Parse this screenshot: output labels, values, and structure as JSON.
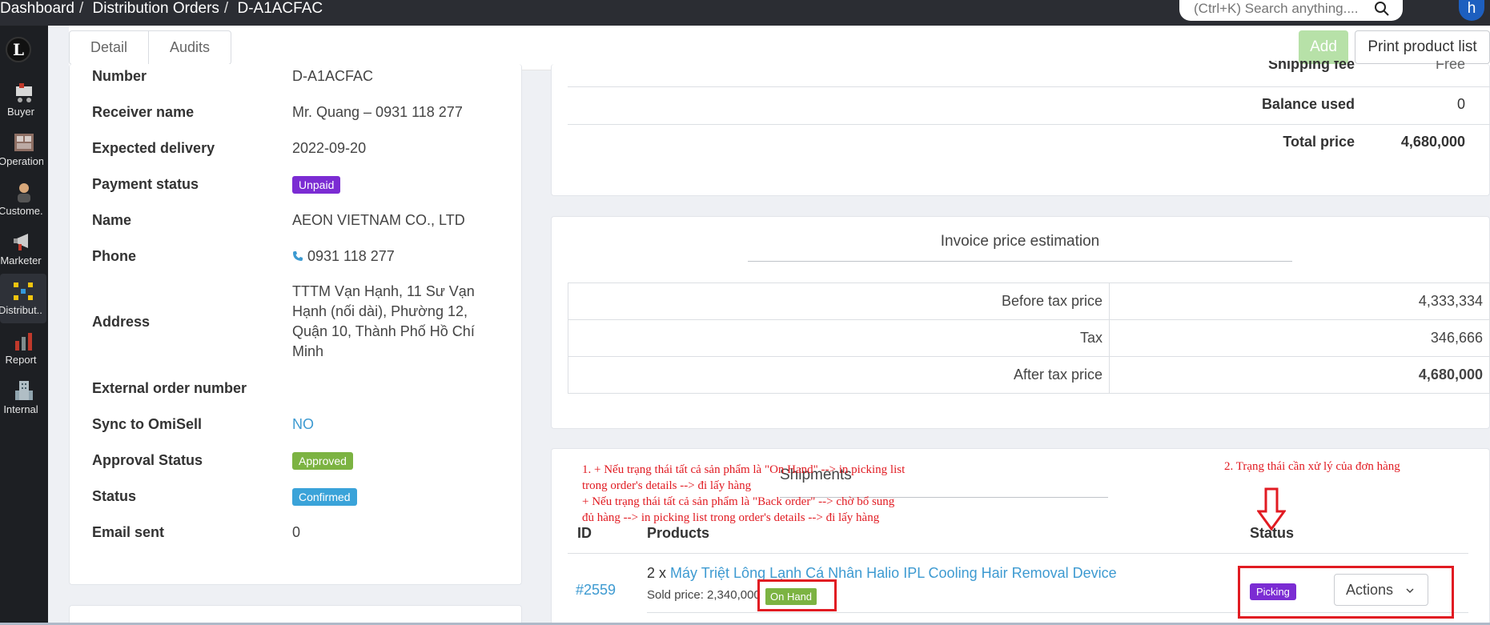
{
  "topbar": {
    "breadcrumb": [
      "Dashboard",
      "Distribution Orders",
      "D-A1ACFAC"
    ],
    "search_placeholder": "(Ctrl+K) Search anything....",
    "avatar_initial": "h"
  },
  "sidebar": {
    "logo": "L",
    "items": [
      {
        "label": "Buyer",
        "icon": "cart-icon"
      },
      {
        "label": "Operation",
        "icon": "warehouse-icon"
      },
      {
        "label": "Custome...",
        "icon": "customer-icon"
      },
      {
        "label": "Marketer",
        "icon": "megaphone-icon"
      },
      {
        "label": "Distribut...",
        "icon": "distribution-icon"
      },
      {
        "label": "Report",
        "icon": "report-icon"
      },
      {
        "label": "Internal",
        "icon": "building-icon"
      }
    ]
  },
  "tabs": [
    "Detail",
    "Audits"
  ],
  "buttons": {
    "add": "Add",
    "print": "Print product list"
  },
  "details": {
    "number_label": "Number",
    "number": "D-A1ACFAC",
    "receiver_label": "Receiver name",
    "receiver": "Mr. Quang – 0931 118 277",
    "expected_label": "Expected delivery",
    "expected": "2022-09-20",
    "payment_label": "Payment status",
    "payment": "Unpaid",
    "name_label": "Name",
    "name": "AEON VIETNAM CO., LTD",
    "phone_label": "Phone",
    "phone": "0931 118 277",
    "address_label": "Address",
    "address_lines": [
      "TTTM Vạn Hạnh, 11 Sư Vạn",
      "Hạnh (nối dài), Phường 12,",
      "Quận 10, Thành Phố Hồ Chí",
      "Minh"
    ],
    "external_label": "External order number",
    "external": "",
    "sync_label": "Sync to OmiSell",
    "sync": "NO",
    "approval_label": "Approval Status",
    "approval": "Approved",
    "status_label": "Status",
    "status": "Confirmed",
    "email_label": "Email sent",
    "email": "0"
  },
  "summary": {
    "shipping_label": "Shipping fee",
    "shipping": "Free",
    "balance_label": "Balance used",
    "balance": "0",
    "total_label": "Total price",
    "total": "4,680,000"
  },
  "invoice": {
    "title": "Invoice price estimation",
    "rows": [
      {
        "label": "Before tax price",
        "value": "4,333,334"
      },
      {
        "label": "Tax",
        "value": "346,666"
      },
      {
        "label": "After tax price",
        "value": "4,680,000"
      }
    ]
  },
  "shipments": {
    "title": "Shipments",
    "col_id": "ID",
    "col_products": "Products",
    "col_status": "Status",
    "order_id": "#2559",
    "qty": "2 x",
    "product": "Máy Triệt Lông Lạnh Cá Nhân Halio IPL Cooling Hair Removal Device",
    "sold_price": "Sold price: 2,340,000",
    "stock_badge": "On Hand",
    "status_badge": "Picking",
    "actions": "Actions"
  },
  "annotations": {
    "note1_lines": [
      "1. + Nếu trạng thái tất cả sản phẩm là \"On Hand\" --> in picking list",
      "trong order's details --> đi lấy hàng",
      "    + Nếu trạng thái tất cả sản phẩm là \"Back order\" --> chờ bổ sung",
      "đủ hàng -->  in picking list trong order's details --> đi lấy hàng"
    ],
    "note2": "2. Trạng thái cần xử lý của đơn hàng"
  },
  "colors": {
    "accent": "#3d9ad1",
    "unpaid": "#7b2cd3",
    "approved": "#7cb342",
    "confirmed": "#3aa3d9",
    "annotation": "#e11b22"
  }
}
